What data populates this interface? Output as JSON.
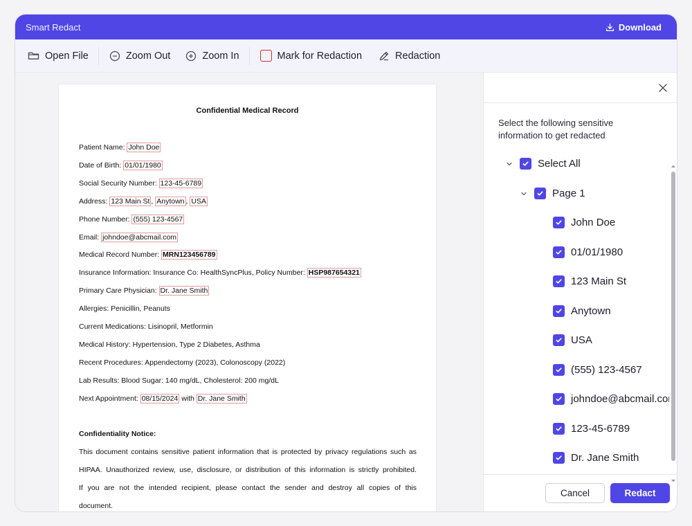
{
  "titlebar": {
    "title": "Smart Redact",
    "download_label": "Download"
  },
  "toolbar": {
    "open_file": "Open File",
    "zoom_out": "Zoom Out",
    "zoom_in": "Zoom In",
    "mark_for_redaction": "Mark for Redaction",
    "redaction": "Redaction"
  },
  "document": {
    "title": "Confidential Medical Record",
    "fields": [
      {
        "label": "Patient Name: ",
        "marks": [
          "John Doe"
        ]
      },
      {
        "label": "Date of Birth: ",
        "marks": [
          "01/01/1980"
        ]
      },
      {
        "label": "Social Security Number: ",
        "marks": [
          "123-45-6789"
        ]
      },
      {
        "label": "Address: ",
        "marks": [
          "123 Main St",
          "Anytown",
          "USA"
        ],
        "sep": ", "
      },
      {
        "label": "Phone Number: ",
        "marks": [
          "(555) 123-4567"
        ]
      },
      {
        "label": "Email: ",
        "marks": [
          "johndoe@abcmail.com"
        ]
      },
      {
        "label": "Medical Record Number: ",
        "marks": [
          "MRN123456789"
        ],
        "bold": true
      },
      {
        "label": "Insurance Information: Insurance Co: HealthSyncPlus, Policy Number: ",
        "marks": [
          "HSP987654321"
        ],
        "bold": true
      },
      {
        "label": "Primary Care Physician: ",
        "marks": [
          "Dr. Jane Smith"
        ]
      },
      {
        "label": "Allergies: Penicillin, Peanuts",
        "marks": []
      },
      {
        "label": "Current Medications: Lisinopril, Metformin",
        "marks": []
      },
      {
        "label": "Medical History: Hypertension, Type 2 Diabetes, Asthma",
        "marks": []
      },
      {
        "label": "Recent Procedures: Appendectomy (2023), Colonoscopy (2022)",
        "marks": []
      },
      {
        "label": "Lab Results: Blood Sugar: 140 mg/dL, Cholesterol: 200 mg/dL",
        "marks": []
      },
      {
        "label": "Next Appointment: ",
        "marks": [
          "08/15/2024",
          "Dr. Jane Smith"
        ],
        "sep": " with "
      }
    ],
    "notice_heading": "Confidentiality Notice:",
    "notice_lines": [
      "This document contains sensitive patient information that is protected by privacy regulations such as",
      "HIPAA. Unauthorized review, use, disclosure, or distribution of this information is strictly prohibited.",
      "If you are not the intended recipient, please contact the sender and destroy all copies of this",
      "document."
    ]
  },
  "panel": {
    "instructions": "Select the following sensitive information to get redacted",
    "select_all": "Select All",
    "page_label": "Page 1",
    "items": [
      "John Doe",
      "01/01/1980",
      "123 Main St",
      "Anytown",
      "USA",
      "(555) 123-4567",
      "johndoe@abcmail.com",
      "123-45-6789",
      "Dr. Jane Smith"
    ],
    "cancel_label": "Cancel",
    "redact_label": "Redact"
  },
  "colors": {
    "accent": "#4f46e5",
    "redaction_mark": "#e39a9a",
    "mark_icon": "#d12a2a"
  }
}
